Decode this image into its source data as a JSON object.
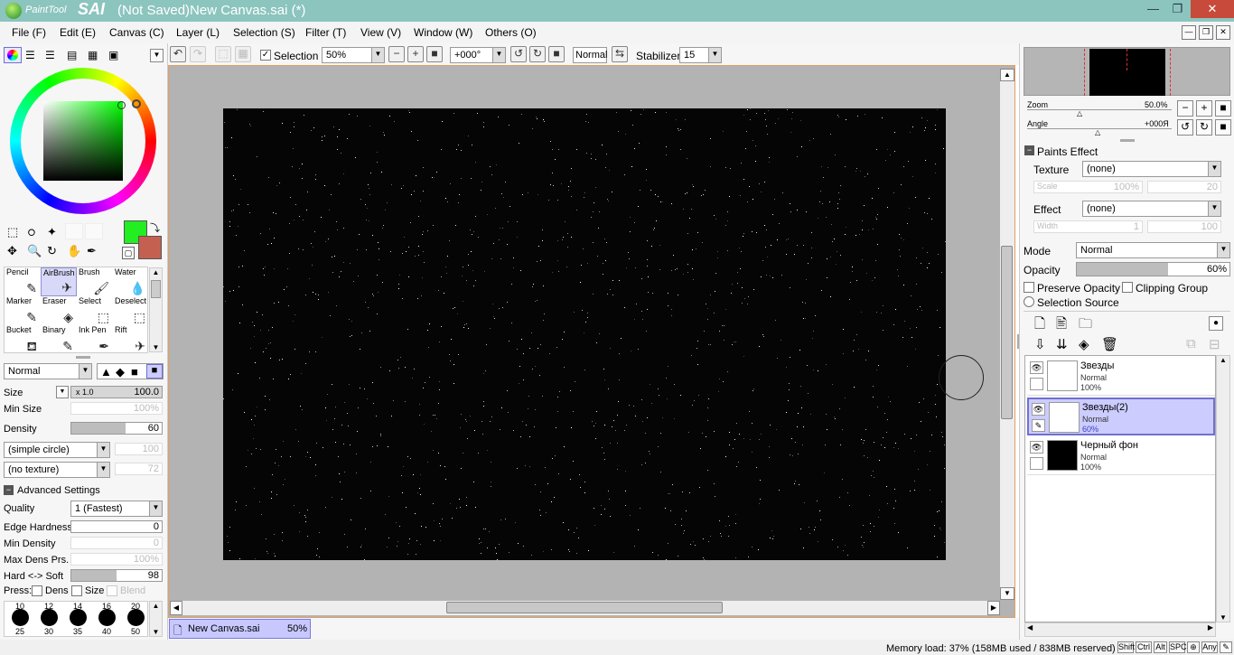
{
  "window": {
    "app_logo_text": "PaintTool",
    "app_logo_sai": "SAI",
    "title": "(Not Saved)New Canvas.sai (*)"
  },
  "menu": [
    "File (F)",
    "Edit (E)",
    "Canvas (C)",
    "Layer (L)",
    "Selection (S)",
    "Filter (T)",
    "View (V)",
    "Window (W)",
    "Others (O)"
  ],
  "toolbar": {
    "selection_label": "Selection",
    "selection_checked": true,
    "zoom": "50%",
    "angle": "+000°",
    "blend": "Normal",
    "stabilizer_label": "Stabilizer",
    "stabilizer": "15"
  },
  "tools": {
    "rows": [
      [
        {
          "label": "Pencil",
          "icon": "✎"
        },
        {
          "label": "AirBrush",
          "icon": "✈",
          "active": true
        },
        {
          "label": "Brush",
          "icon": "🖌"
        },
        {
          "label": "Water",
          "icon": "💧"
        }
      ],
      [
        {
          "label": "Marker",
          "icon": "✎"
        },
        {
          "label": "Eraser",
          "icon": "◈"
        },
        {
          "label": "Select",
          "icon": "⬚"
        },
        {
          "label": "Deselect",
          "icon": "⬚"
        }
      ],
      [
        {
          "label": "Bucket",
          "icon": "⛾"
        },
        {
          "label": "Binary",
          "icon": "✎"
        },
        {
          "label": "Ink Pen",
          "icon": "✒"
        },
        {
          "label": "Rift",
          "icon": "✈"
        }
      ]
    ]
  },
  "brush_settings": {
    "mode": "Normal",
    "size_label": "Size",
    "size_mult": "x 1.0",
    "size": "100.0",
    "min_size_label": "Min Size",
    "min_size": "100%",
    "density_label": "Density",
    "density": "60",
    "density_fraction": 0.6,
    "shape": "(simple circle)",
    "shape_val": "100",
    "texture": "(no texture)",
    "texture_val": "72",
    "advanced_label": "Advanced Settings",
    "quality_label": "Quality",
    "quality": "1 (Fastest)",
    "edge_hardness_label": "Edge Hardness",
    "edge_hardness": "0",
    "min_density_label": "Min Density",
    "min_density": "0",
    "max_dens_label": "Max Dens Prs.",
    "max_dens": "100%",
    "hard_soft_label": "Hard <-> Soft",
    "hard_soft": "98",
    "hard_soft_fraction": 0.5,
    "press_label": "Press:",
    "press_dens": "Dens",
    "press_size": "Size",
    "press_blend": "Blend"
  },
  "brush_sizes": [
    {
      "top": "10",
      "bottom": "25"
    },
    {
      "top": "12",
      "bottom": "30"
    },
    {
      "top": "14",
      "bottom": "35"
    },
    {
      "top": "16",
      "bottom": "40"
    },
    {
      "top": "20",
      "bottom": "50"
    }
  ],
  "colors": {
    "primary": "#22ee22",
    "secondary": "#c46050",
    "canvas_bg": "#050505",
    "workspace": "#b3b3b3",
    "accent": "#7070d0"
  },
  "document_tab": {
    "name": "New Canvas.sai",
    "zoom": "50%"
  },
  "navigator": {
    "zoom_label": "Zoom",
    "zoom": "50.0%",
    "angle_label": "Angle",
    "angle": "+000Я"
  },
  "paints_effect": {
    "title": "Paints Effect",
    "texture_label": "Texture",
    "texture": "(none)",
    "scale_label": "Scale",
    "scale_pct": "100%",
    "scale_val": "20",
    "effect_label": "Effect",
    "effect": "(none)",
    "width_label": "Width",
    "width_val": "1",
    "width_val2": "100"
  },
  "layer_props": {
    "mode_label": "Mode",
    "mode": "Normal",
    "opacity_label": "Opacity",
    "opacity": "60%",
    "opacity_fraction": 0.6,
    "preserve_opacity": "Preserve Opacity",
    "clipping_group": "Clipping Group",
    "selection_source": "Selection Source"
  },
  "layers": [
    {
      "name": "Звезды",
      "mode": "Normal",
      "opacity": "100%",
      "active": false,
      "thumb": "#ffffff"
    },
    {
      "name": "Звезды(2)",
      "mode": "Normal",
      "opacity": "60%",
      "active": true,
      "thumb": "#ffffff"
    },
    {
      "name": "Черный фон",
      "mode": "Normal",
      "opacity": "100%",
      "active": false,
      "thumb": "#000000"
    }
  ],
  "status": {
    "memory": "Memory load: 37% (158MB used / 838MB reserved)",
    "keys": [
      "Shift",
      "Ctrl",
      "Alt",
      "SPC",
      "⊕",
      "Any",
      "✎"
    ]
  }
}
